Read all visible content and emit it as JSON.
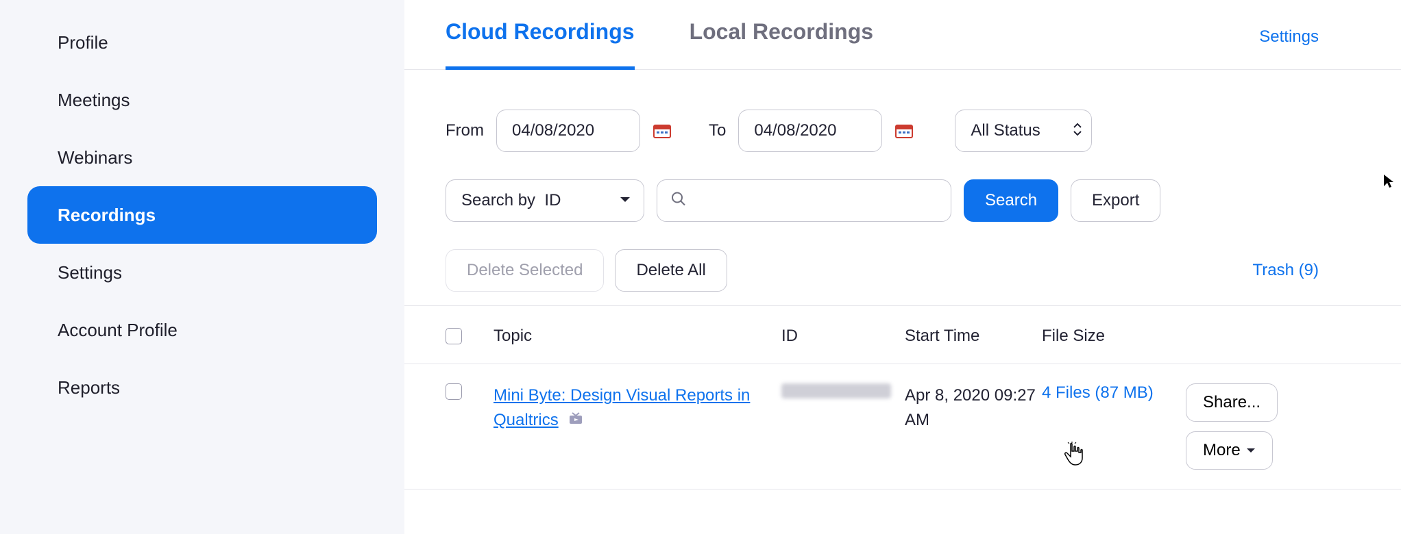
{
  "sidebar": {
    "items": [
      {
        "label": "Profile"
      },
      {
        "label": "Meetings"
      },
      {
        "label": "Webinars"
      },
      {
        "label": "Recordings"
      },
      {
        "label": "Settings"
      },
      {
        "label": "Account Profile"
      },
      {
        "label": "Reports"
      }
    ],
    "active_index": 3
  },
  "tabs": {
    "items": [
      {
        "label": "Cloud Recordings"
      },
      {
        "label": "Local Recordings"
      }
    ],
    "active_index": 0,
    "settings_link": "Settings"
  },
  "filters": {
    "from_label": "From",
    "from_value": "04/08/2020",
    "to_label": "To",
    "to_value": "04/08/2020",
    "status_value": "All Status",
    "searchby_value": "Search by  ID",
    "search_value": "",
    "search_button": "Search",
    "export_button": "Export"
  },
  "actions": {
    "delete_selected": "Delete Selected",
    "delete_all": "Delete All",
    "trash": "Trash (9)"
  },
  "table": {
    "headers": {
      "topic": "Topic",
      "id": "ID",
      "start": "Start Time",
      "size": "File Size"
    },
    "rows": [
      {
        "topic": "Mini Byte: Design Visual Reports in Qualtrics",
        "id_masked": true,
        "start": "Apr 8, 2020 09:27 AM",
        "size": "4 Files (87 MB)",
        "share_btn": "Share...",
        "more_btn": "More"
      }
    ]
  }
}
